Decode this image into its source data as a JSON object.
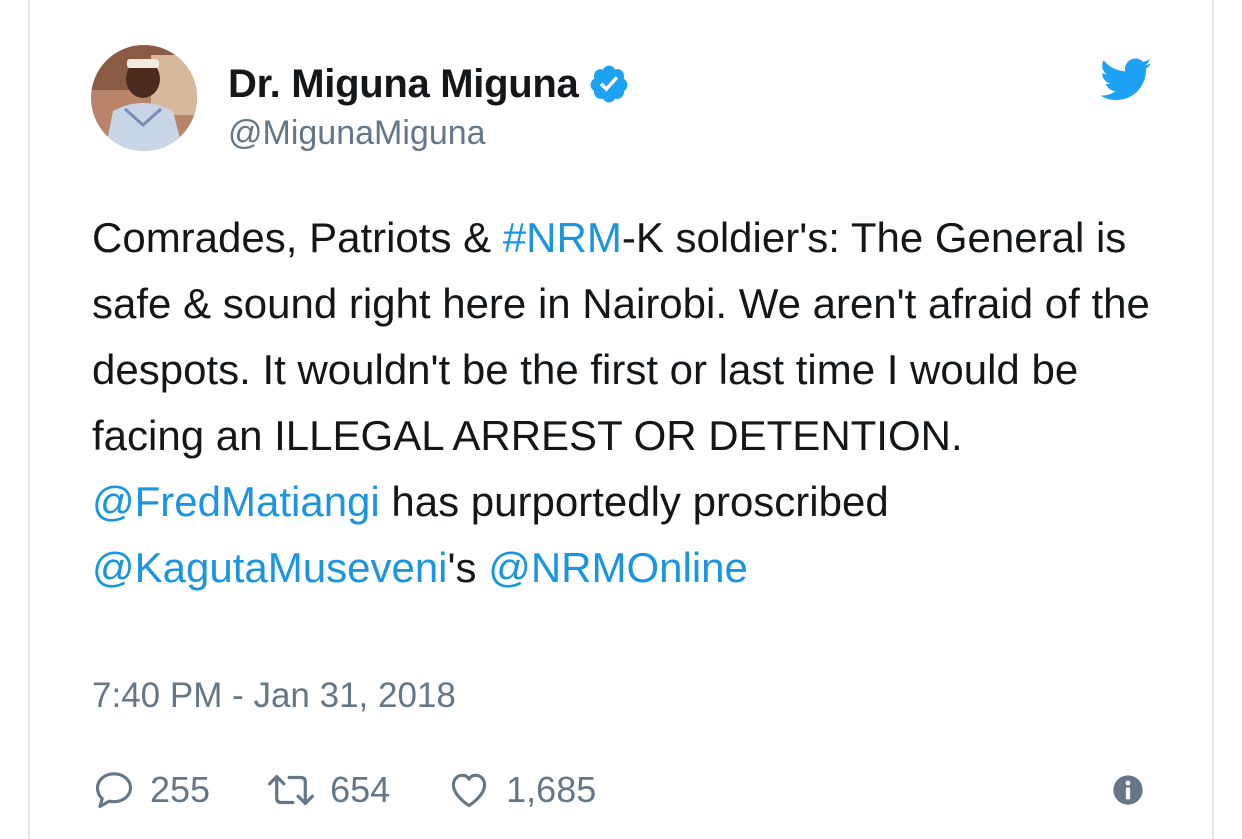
{
  "user": {
    "display_name": "Dr. Miguna Miguna",
    "handle": "@MigunaMiguna",
    "verified": true
  },
  "tweet": {
    "segments": [
      {
        "text": "Comrades, Patriots & ",
        "type": "text"
      },
      {
        "text": "#NRM",
        "type": "link"
      },
      {
        "text": "-K soldier's: The General is safe & sound right here in Nairobi. We aren't afraid of the despots. It wouldn't be the first or last time I would be facing an ILLEGAL ARREST OR DETENTION. ",
        "type": "text"
      },
      {
        "text": "@FredMatiangi",
        "type": "link"
      },
      {
        "text": " has purportedly proscribed ",
        "type": "text"
      },
      {
        "text": "@KagutaMuseveni",
        "type": "link"
      },
      {
        "text": "'s ",
        "type": "text"
      },
      {
        "text": "@NRMOnline",
        "type": "link"
      }
    ],
    "timestamp": "7:40 PM - Jan 31, 2018"
  },
  "actions": {
    "replies": "255",
    "retweets": "654",
    "likes": "1,685"
  },
  "colors": {
    "link": "#1b95e0",
    "text": "#14171a",
    "muted": "#657786",
    "brand": "#1da1f2"
  },
  "icons": {
    "avatar": "profile-photo",
    "verified": "verified-badge-icon",
    "brand": "twitter-bird-icon",
    "reply": "reply-icon",
    "retweet": "retweet-icon",
    "like": "heart-icon",
    "info": "info-icon"
  }
}
